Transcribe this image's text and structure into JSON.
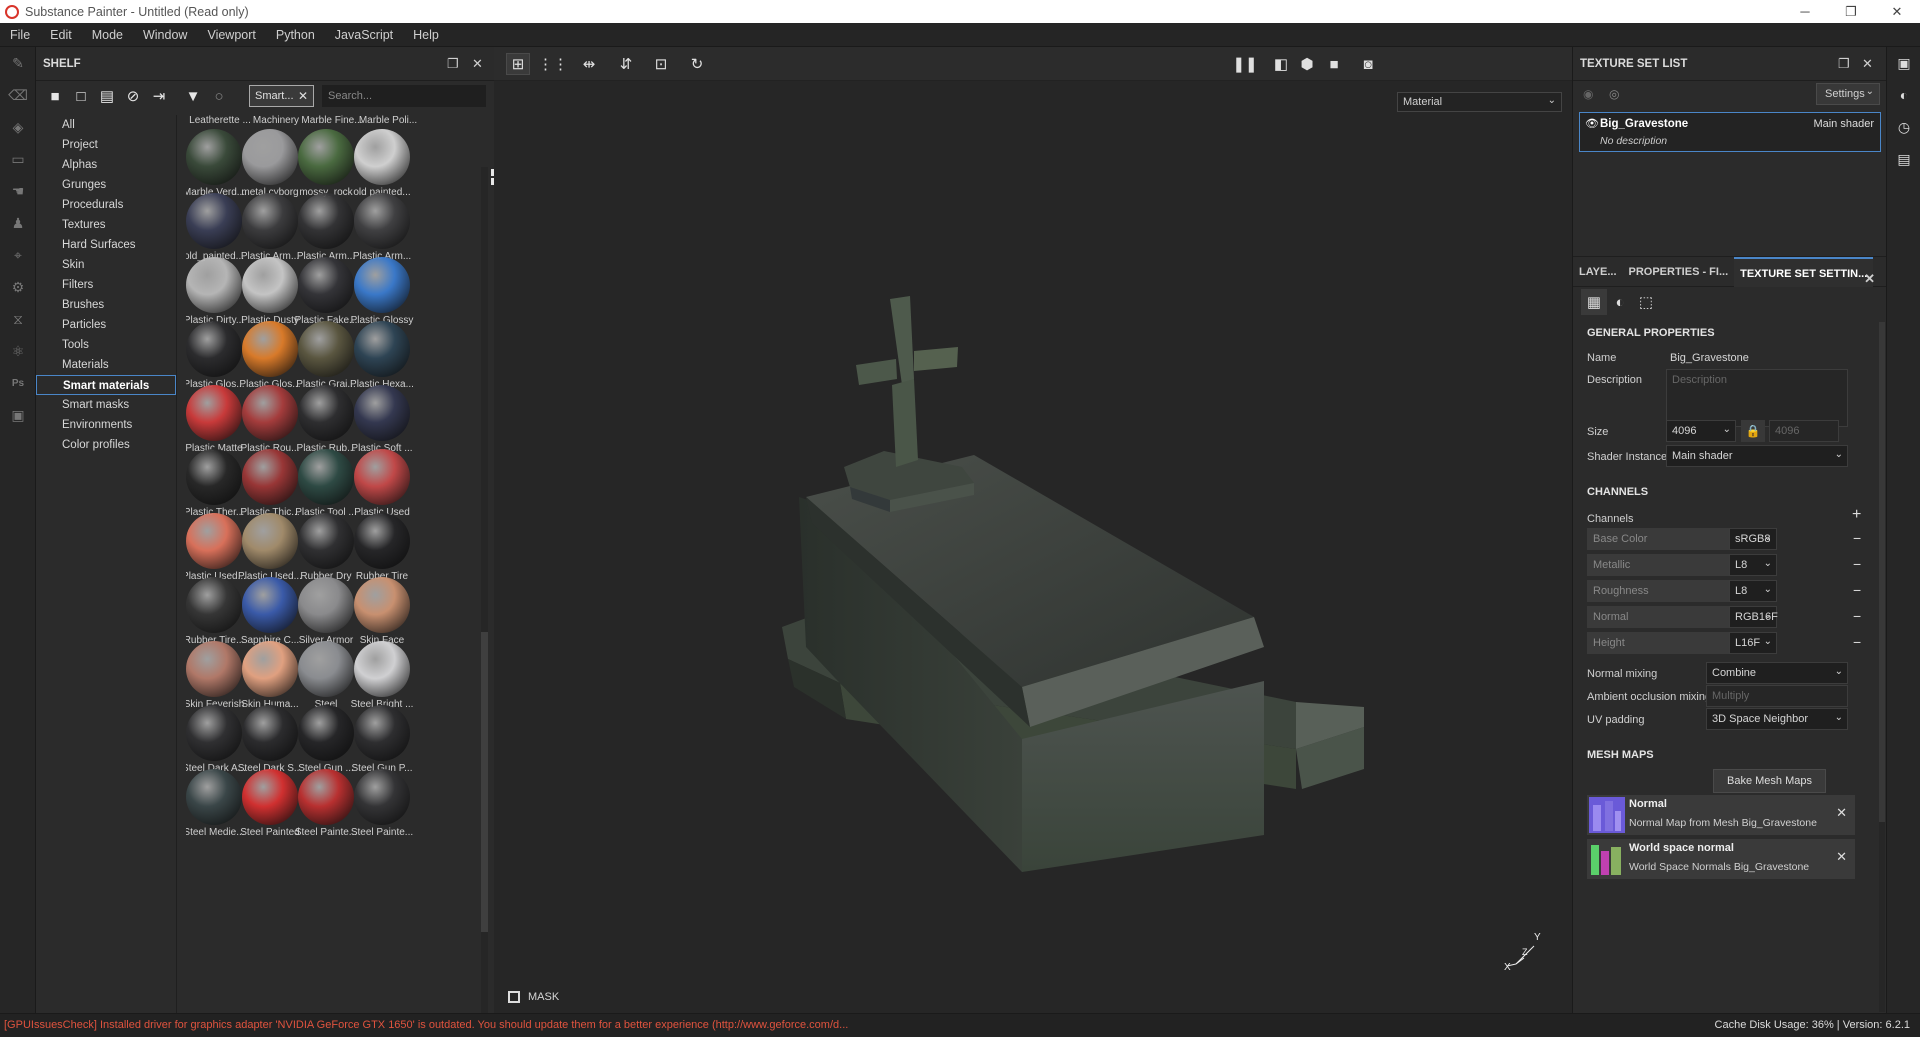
{
  "window": {
    "title": "Substance Painter - Untitled (Read only)",
    "minimize": "─",
    "maximize": "❐",
    "close": "✕"
  },
  "menu": [
    "File",
    "Edit",
    "Mode",
    "Window",
    "Viewport",
    "Python",
    "JavaScript",
    "Help"
  ],
  "shelf": {
    "title": "SHELF",
    "filter_chip": "Smart...",
    "search_placeholder": "Search...",
    "categories": [
      "All",
      "Project",
      "Alphas",
      "Grunges",
      "Procedurals",
      "Textures",
      "Hard Surfaces",
      "Skin",
      "Filters",
      "Brushes",
      "Particles",
      "Tools",
      "Materials",
      "Smart materials",
      "Smart masks",
      "Environments",
      "Color profiles"
    ],
    "selected_category": "Smart materials",
    "top_labels": [
      "Leatherette ...",
      "Machinery",
      "Marble Fine...",
      "Marble Poli..."
    ],
    "materials": [
      {
        "label": "Marble Verd...",
        "color": "#3a4a3a"
      },
      {
        "label": "metal cyborg",
        "color": "#9a9a9c"
      },
      {
        "label": "mossy_rock",
        "color": "#4a6a40"
      },
      {
        "label": "old painted...",
        "color": "#cfcfcf"
      },
      {
        "label": "old_painted...",
        "color": "#3a3e55"
      },
      {
        "label": "Plastic Arm...",
        "color": "#3c3c3e"
      },
      {
        "label": "Plastic Arm...",
        "color": "#333335"
      },
      {
        "label": "Plastic Arm...",
        "color": "#404042"
      },
      {
        "label": "Plastic Dirty...",
        "color": "#b5b5b5"
      },
      {
        "label": "Plastic Dusty",
        "color": "#c4c4c4"
      },
      {
        "label": "Plastic Fake...",
        "color": "#343438"
      },
      {
        "label": "Plastic Glossy",
        "color": "#3a78c8"
      },
      {
        "label": "Plastic Glos...",
        "color": "#2c2c2e"
      },
      {
        "label": "Plastic Glos...",
        "color": "#d87a2a"
      },
      {
        "label": "Plastic Grai...",
        "color": "#5a5640"
      },
      {
        "label": "Plastic Hexa...",
        "color": "#2e4454"
      },
      {
        "label": "Plastic Matte",
        "color": "#c83a3a"
      },
      {
        "label": "Plastic Rou...",
        "color": "#a43c3c"
      },
      {
        "label": "Plastic Rub...",
        "color": "#2e2e30"
      },
      {
        "label": "Plastic Soft ...",
        "color": "#343850"
      },
      {
        "label": "Plastic Ther...",
        "color": "#282828"
      },
      {
        "label": "Plastic Thic...",
        "color": "#983636"
      },
      {
        "label": "Plastic Tool ...",
        "color": "#2e4a44"
      },
      {
        "label": "Plastic Used",
        "color": "#c04848"
      },
      {
        "label": "Plastic Used...",
        "color": "#d8705a"
      },
      {
        "label": "Plastic Used...",
        "color": "#a08a6a"
      },
      {
        "label": "Rubber Dry",
        "color": "#303032"
      },
      {
        "label": "Rubber Tire",
        "color": "#262628"
      },
      {
        "label": "Rubber Tire...",
        "color": "#363636"
      },
      {
        "label": "Sapphire C...",
        "color": "#3a5aa8"
      },
      {
        "label": "Silver Armor",
        "color": "#8a8a8c"
      },
      {
        "label": "Skin Face",
        "color": "#c89070"
      },
      {
        "label": "Skin Feverish",
        "color": "#b07868"
      },
      {
        "label": "Skin Huma...",
        "color": "#e0a080"
      },
      {
        "label": "Steel",
        "color": "#8a8c90"
      },
      {
        "label": "Steel Bright ...",
        "color": "#d0d0d2"
      },
      {
        "label": "Steel Dark A...",
        "color": "#303032"
      },
      {
        "label": "Steel Dark S...",
        "color": "#2c2c2e"
      },
      {
        "label": "Steel Gun ...",
        "color": "#262628"
      },
      {
        "label": "Steel Gun P...",
        "color": "#2e2e30"
      },
      {
        "label": "Steel Medie...",
        "color": "#3a4648"
      },
      {
        "label": "Steel Painted",
        "color": "#d03030"
      },
      {
        "label": "Steel Painte...",
        "color": "#b83030"
      },
      {
        "label": "Steel Painte...",
        "color": "#343436"
      }
    ]
  },
  "viewport": {
    "material_mode": "Material",
    "mask_label": "MASK",
    "axis_y": "Y",
    "axis_z": "Z",
    "axis_x": "X"
  },
  "texture_set_list": {
    "title": "TEXTURE SET LIST",
    "settings_label": "Settings",
    "item_name": "Big_Gravestone",
    "item_shader": "Main shader",
    "item_description": "No description"
  },
  "tabs": [
    "LAYE...",
    "PROPERTIES - FI...",
    "TEXTURE SET SETTIN..."
  ],
  "settings": {
    "general_title": "GENERAL PROPERTIES",
    "name_label": "Name",
    "name_value": "Big_Gravestone",
    "description_label": "Description",
    "description_placeholder": "Description",
    "size_label": "Size",
    "size_value": "4096",
    "size_value2": "4096",
    "shader_label": "Shader Instance",
    "shader_value": "Main shader",
    "channels_title": "CHANNELS",
    "channels_label": "Channels",
    "channels": [
      {
        "name": "Base Color",
        "format": "sRGB8"
      },
      {
        "name": "Metallic",
        "format": "L8"
      },
      {
        "name": "Roughness",
        "format": "L8"
      },
      {
        "name": "Normal",
        "format": "RGB16F"
      },
      {
        "name": "Height",
        "format": "L16F"
      }
    ],
    "normal_mixing_label": "Normal mixing",
    "normal_mixing_value": "Combine",
    "ao_mixing_label": "Ambient occlusion mixing",
    "ao_mixing_value": "Multiply",
    "uv_padding_label": "UV padding",
    "uv_padding_value": "3D Space Neighbor",
    "mesh_maps_title": "MESH MAPS",
    "bake_label": "Bake Mesh Maps",
    "mesh_maps": [
      {
        "title": "Normal",
        "subtitle": "Normal Map from Mesh Big_Gravestone"
      },
      {
        "title": "World space normal",
        "subtitle": "World Space Normals Big_Gravestone"
      }
    ]
  },
  "status": {
    "message": "[GPUIssuesCheck] Installed driver for graphics adapter 'NVIDIA GeForce GTX 1650' is outdated. You should update them for a better experience (http://www.geforce.com/d...",
    "cache": "Cache Disk Usage:    36% | Version: 6.2.1"
  }
}
